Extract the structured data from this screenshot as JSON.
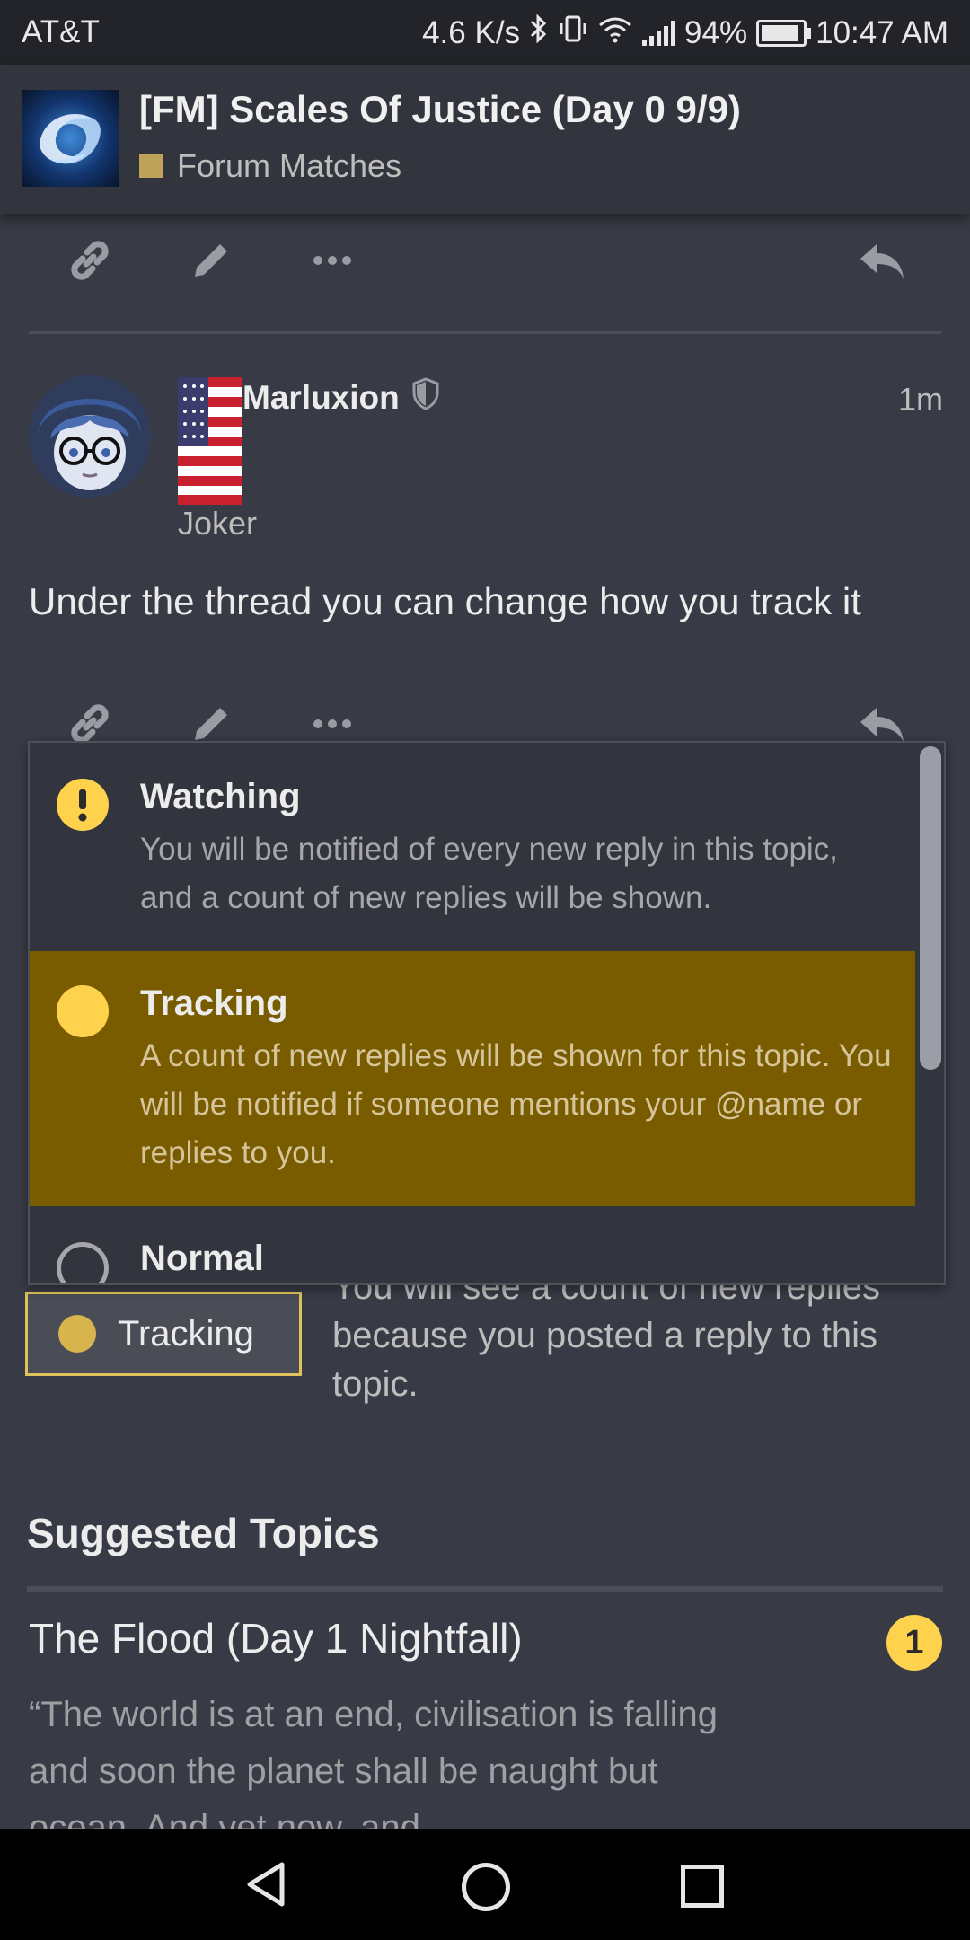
{
  "status_bar": {
    "carrier": "AT&T",
    "net_speed": "4.6 K/s",
    "battery": "94%",
    "time": "10:47 AM"
  },
  "header": {
    "title": "[FM] Scales Of Justice (Day 0 9/9)",
    "category": "Forum Matches",
    "category_color": "#bfa25a"
  },
  "post": {
    "username": "Marluxion",
    "flair": "Joker",
    "time": "1m",
    "body": "Under the thread you can change how you track it"
  },
  "actions": {
    "icons": [
      "link-icon",
      "edit-icon",
      "more-icon",
      "reply-icon"
    ]
  },
  "notification_dropdown": {
    "options": [
      {
        "title": "Watching",
        "description": "You will be notified of every new reply in this topic, and a count of new replies will be shown.",
        "icon": "watching-icon"
      },
      {
        "title": "Tracking",
        "description": "A count of new replies will be shown for this topic. You will be notified if someone mentions your @name or replies to you.",
        "icon": "tracking-icon",
        "selected": true
      },
      {
        "title": "Normal",
        "description": "",
        "icon": "normal-icon"
      }
    ]
  },
  "tracking": {
    "button_label": "Tracking",
    "reason": "You will see a count of new replies because you posted a reply to this topic."
  },
  "suggested": {
    "heading": "Suggested Topics",
    "topics": [
      {
        "title": "The Flood (Day 1 Nightfall)",
        "unread": "1",
        "excerpt": "“The world is at an end, civilisation is falling and soon the planet shall be naught but ocean. And yet now, and"
      }
    ]
  },
  "colors": {
    "accent": "#ffd24d",
    "selected_bg": "#7a5c00",
    "background": "#383b45"
  }
}
